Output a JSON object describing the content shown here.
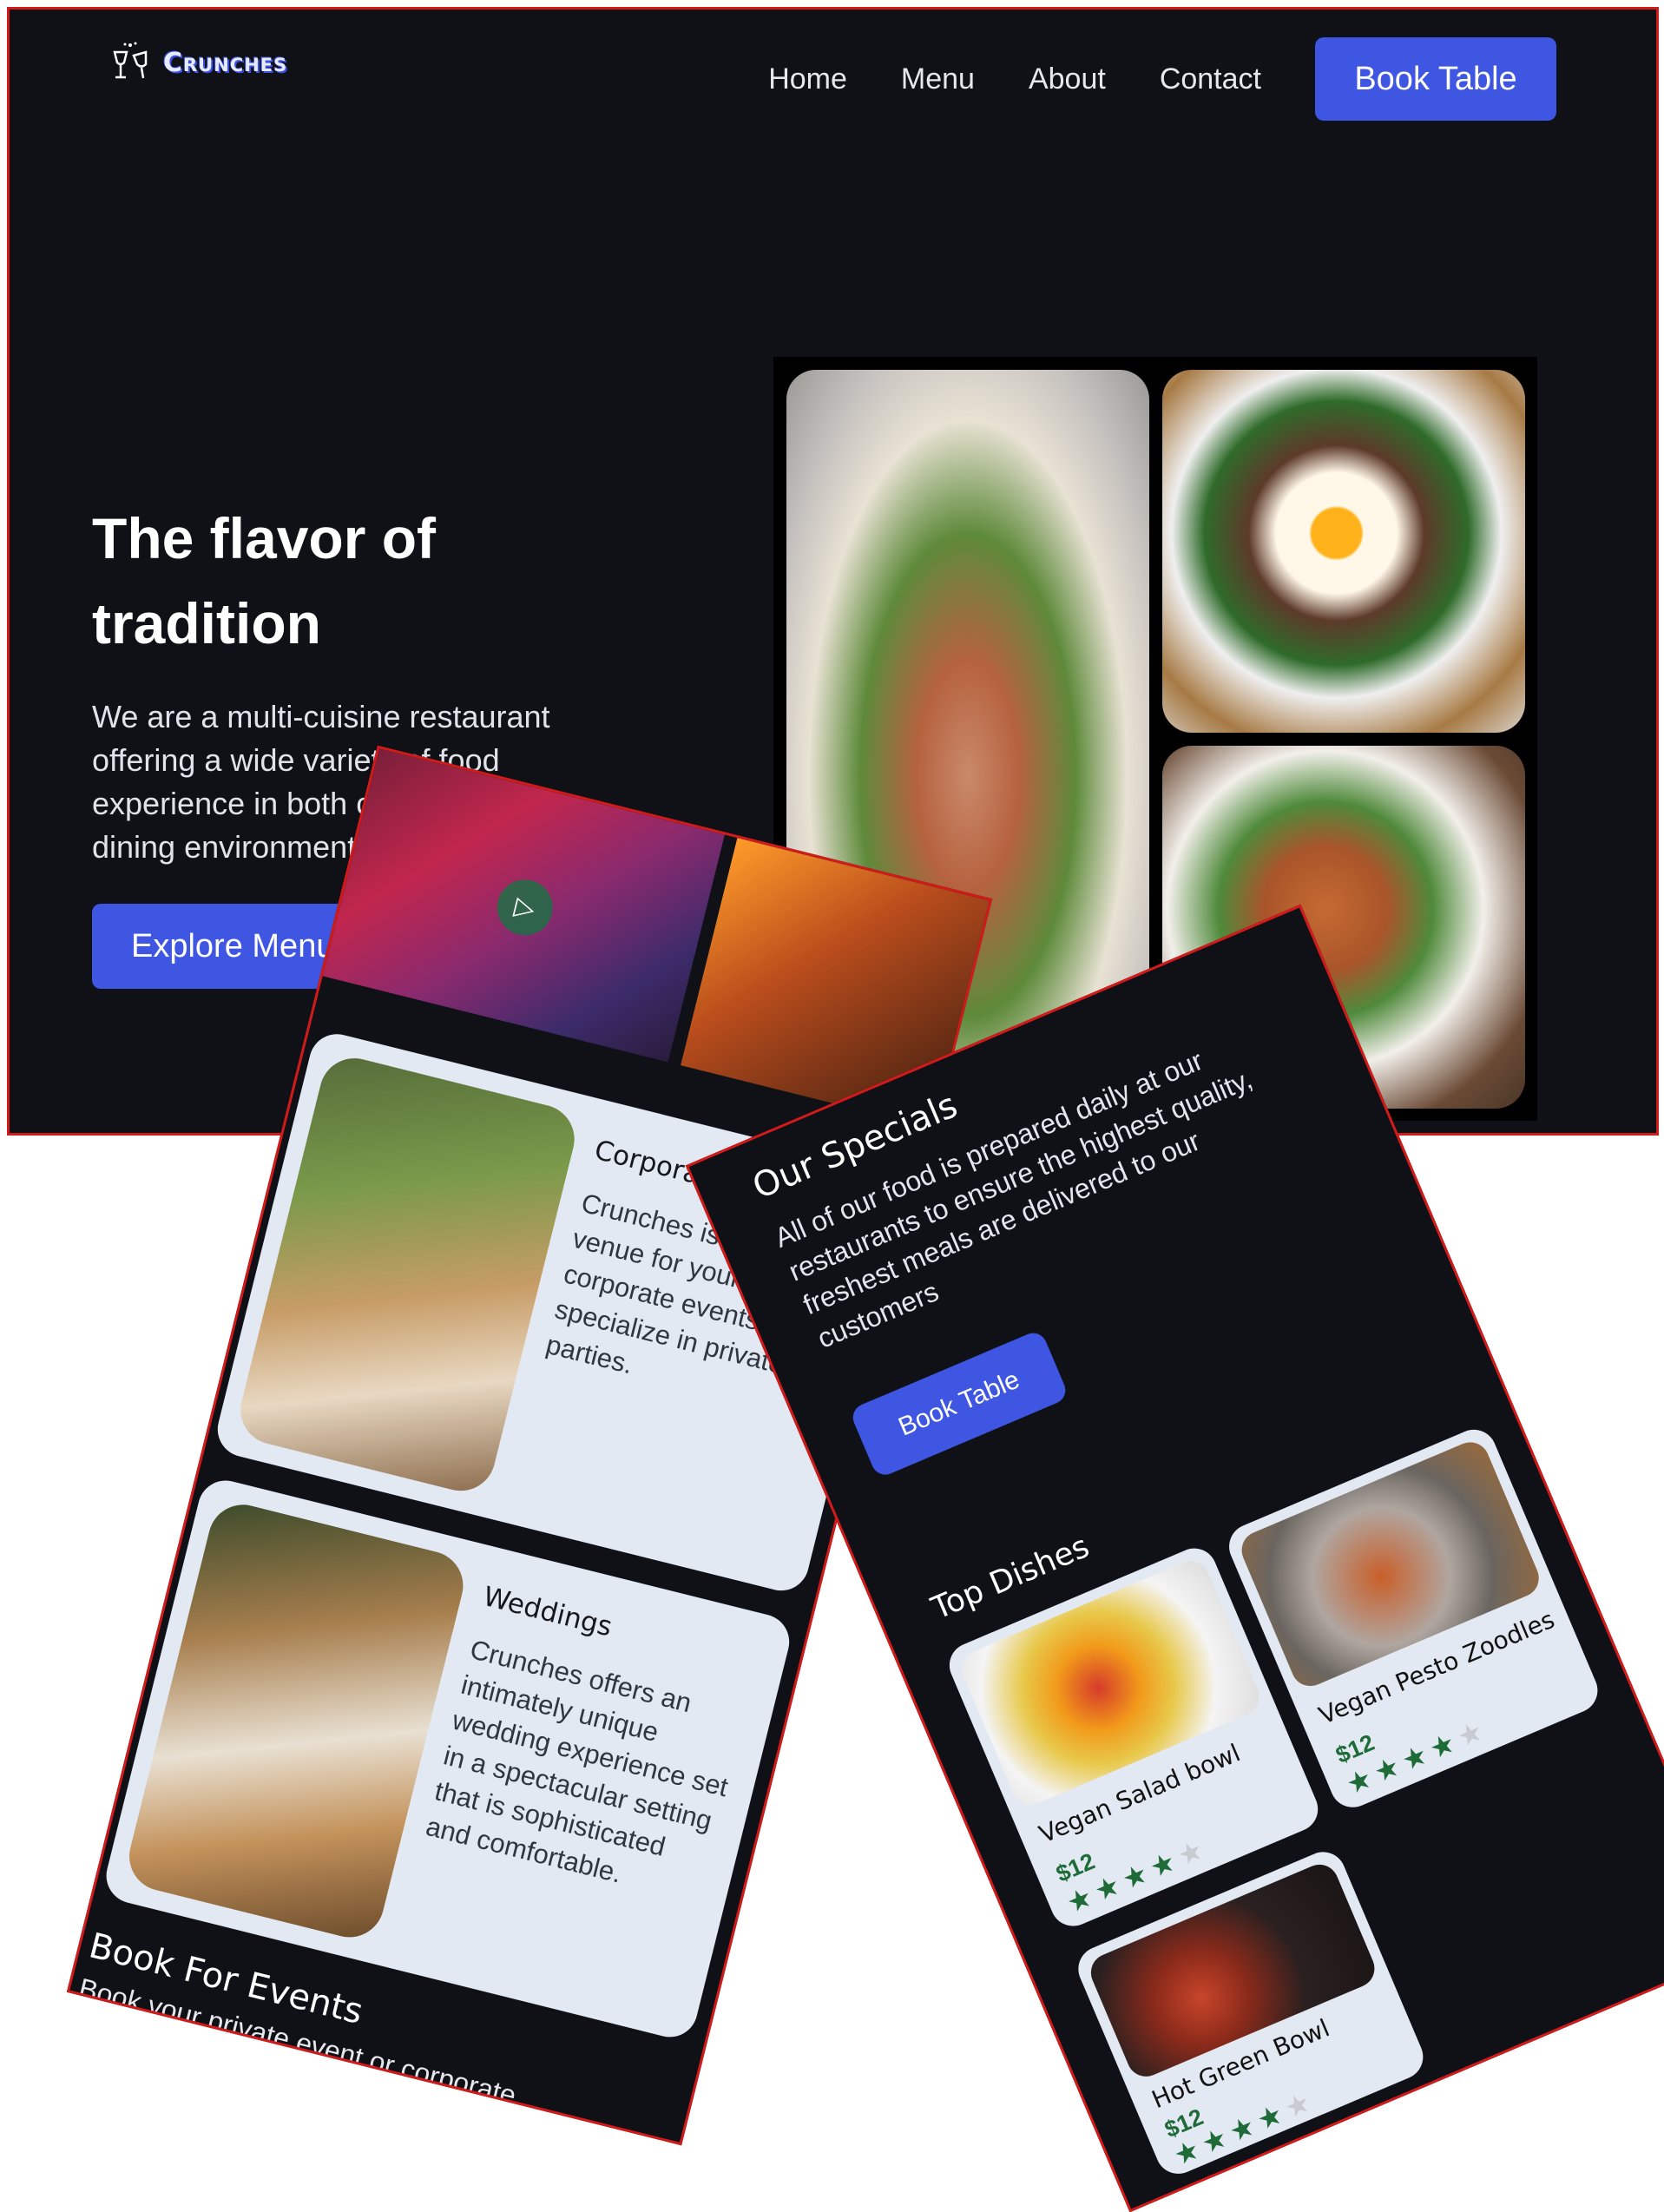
{
  "desktop": {
    "brand": "Crunches",
    "nav": {
      "home": "Home",
      "menu": "Menu",
      "about": "About",
      "contact": "Contact",
      "book_table": "Book Table"
    },
    "hero": {
      "title": "The flavor of tradition",
      "description": "We are a multi-cuisine restaurant offering a wide variety of food experience in both casual and fine dining environment.",
      "button": "Explore Menu"
    }
  },
  "events_mobile": {
    "cards": [
      {
        "title": "Corporate Events",
        "text": "Crunches is the perfect venue for your corporate events. We specialize in private parties."
      },
      {
        "title": "Weddings",
        "text": "Crunches offers an intimately unique wedding experience set in a spectacular setting that is sophisticated and comfortable."
      }
    ],
    "heading": "Book For Events",
    "subtext": "Book your private event or corporate"
  },
  "specials_mobile": {
    "title": "Our Specials",
    "text": "All of our food is prepared daily at our restaurants to ensure the highest quality, freshest meals are delivered to our customers",
    "button": "Book Table",
    "top_dishes_title": "Top Dishes",
    "dishes": [
      {
        "name": "Vegan Salad bowl",
        "price": "$12",
        "rating": 4,
        "max_rating": 5
      },
      {
        "name": "Vegan Pesto Zoodles",
        "price": "$12",
        "rating": 4,
        "max_rating": 5
      },
      {
        "name": "Hot Green Bowl",
        "price": "$12",
        "rating": 4,
        "max_rating": 5
      }
    ]
  },
  "colors": {
    "background": "#0f1117",
    "accent": "#3e56e2",
    "card": "#e3e9f2",
    "price_green": "#1e6b38",
    "frame_red": "#d11a1a"
  }
}
